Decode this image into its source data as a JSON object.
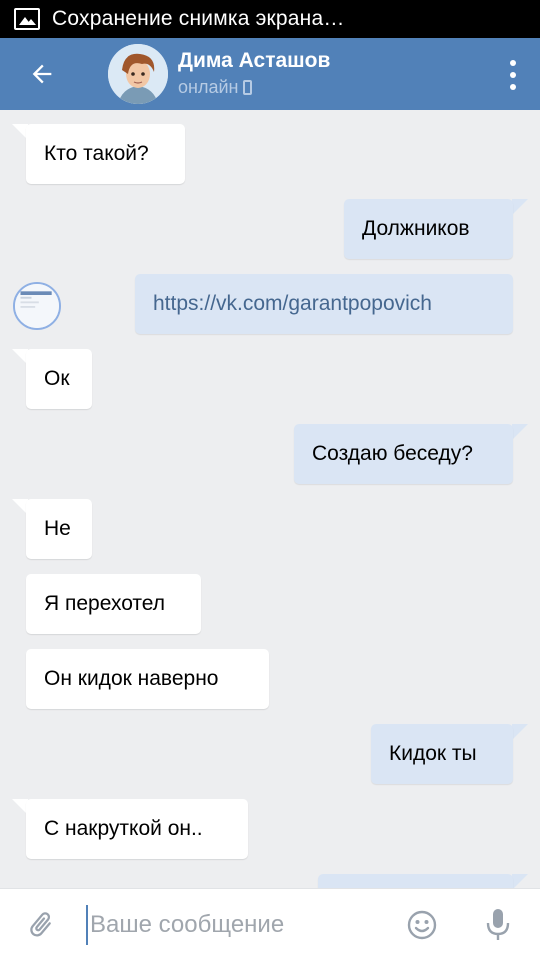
{
  "status_bar": {
    "notification_text": "Сохранение снимка экрана…",
    "icon": "image-icon"
  },
  "header": {
    "back_icon": "arrow-left-icon",
    "contact_name": "Дима Асташов",
    "contact_status": "онлайн",
    "device_icon": "phone-icon",
    "menu_icon": "more-vertical-icon",
    "accent_color": "#5181b8"
  },
  "messages": [
    {
      "direction": "in",
      "text": "Кто такой?"
    },
    {
      "direction": "out",
      "text": "Должников"
    },
    {
      "direction": "out",
      "text": "https://vk.com/garantpopovich",
      "is_link": true
    },
    {
      "direction": "in",
      "text": "Ок"
    },
    {
      "direction": "out",
      "text": "Создаю беседу?"
    },
    {
      "direction": "in",
      "text": "Не"
    },
    {
      "direction": "in",
      "text": "Я перехотел"
    },
    {
      "direction": "in",
      "text": "Он кидок наверно"
    },
    {
      "direction": "out",
      "text": "Кидок ты"
    },
    {
      "direction": "in",
      "text": "С накруткой он.."
    },
    {
      "direction": "out",
      "text": ""
    }
  ],
  "composer": {
    "placeholder": "Ваше сообщение",
    "value": "",
    "attach_icon": "paperclip-icon",
    "emoji_icon": "smile-icon",
    "mic_icon": "microphone-icon"
  },
  "colors": {
    "incoming_bubble": "#ffffff",
    "outgoing_bubble": "#dae5f4",
    "link": "#45678f",
    "background": "#edeef0"
  }
}
